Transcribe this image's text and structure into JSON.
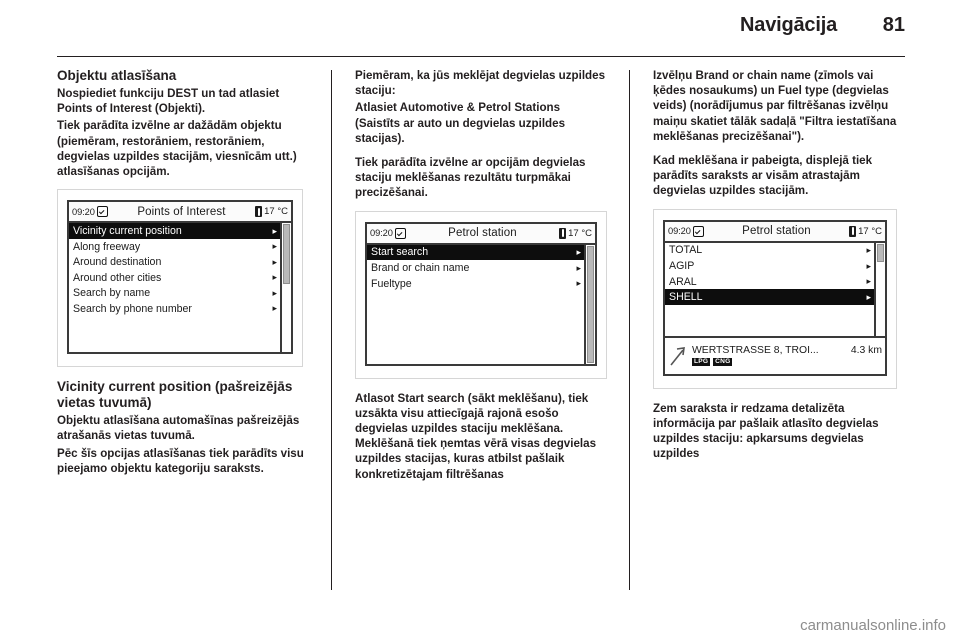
{
  "header": {
    "title": "Navigācija",
    "page_number": "81"
  },
  "columns": {
    "col1": {
      "heading": "Objektu atlasīšana",
      "paragraphs": [
        "Nospiediet funkciju DEST un tad atlasiet Points of Interest (Objekti).",
        "Tiek parādīta izvēlne ar dažādām objektu (piemēram, restorāniem, restorāniem, degvielas uzpildes stacijām, viesnīcām utt.) atlasīšanas opcijām."
      ],
      "heading2": "Vicinity current position (pašreizējās vietas tuvumā)",
      "paragraphs2": [
        "Objektu atlasīšana automašīnas pašreizējās atrašanās vietas tuvumā.",
        "Pēc šīs opcijas atlasīšanas tiek parādīts visu pieejamo objektu kategoriju saraksts."
      ]
    },
    "col2": {
      "paragraphs_top": [
        "Piemēram, ka jūs meklējat degvielas uzpildes staciju:",
        "Atlasiet Automotive & Petrol Stations (Saistīts ar auto un degvielas uzpildes stacijas).",
        "Tiek parādīta izvēlne ar opcijām degvielas staciju meklēšanas rezultātu turpmākai precizēšanai."
      ],
      "paragraphs_bottom": [
        "Atlasot Start search (sākt meklēšanu), tiek uzsākta visu attiecīgajā rajonā esošo degvielas uzpildes staciju meklēšana. Meklēšanā tiek ņemtas vērā visas degvielas uzpildes stacijas, kuras atbilst pašlaik konkretizētajam filtrēšanas"
      ]
    },
    "col3": {
      "paragraphs_top": [
        "Izvēlņu Brand or chain name (zīmols vai ķēdes nosaukums) un Fuel type (degvielas veids) (norādījumus par filtrēšanas izvēlņu maiņu skatiet tālāk sadaļā \"Filtra iestatīšana meklēšanas precizēšanai\").",
        "Kad meklēšana ir pabeigta, displejā tiek parādīts saraksts ar visām atrastajām degvielas uzpildes stacijām."
      ],
      "paragraphs_bottom": [
        "Zem saraksta ir redzama detalizēta informācija par pašlaik atlasīto degvielas uzpildes staciju: apkarsums degvielas uzpildes"
      ]
    }
  },
  "screenshots": {
    "poi": {
      "statusbar": {
        "clock": "09:20",
        "clock_icon": "clock-checkmark-icon",
        "title": "Points of Interest",
        "thermo_icon": "thermometer-icon",
        "temperature": "17 °C"
      },
      "rows": [
        {
          "label": "Vicinity current position",
          "selected": true,
          "chevron": "▸"
        },
        {
          "label": "Along freeway",
          "selected": false,
          "chevron": "▸"
        },
        {
          "label": "Around destination",
          "selected": false,
          "chevron": "▸"
        },
        {
          "label": "Around other cities",
          "selected": false,
          "chevron": "▸"
        },
        {
          "label": "Search by name",
          "selected": false,
          "chevron": "▸"
        },
        {
          "label": "Search by phone number",
          "selected": false,
          "chevron": "▸"
        }
      ]
    },
    "petrol_menu": {
      "statusbar": {
        "clock": "09:20",
        "clock_icon": "clock-checkmark-icon",
        "title": "Petrol station",
        "thermo_icon": "thermometer-icon",
        "temperature": "17 °C"
      },
      "rows": [
        {
          "label": "Start search",
          "selected": true,
          "chevron": "▸"
        },
        {
          "label": "Brand or chain name",
          "selected": false,
          "chevron": "▸"
        },
        {
          "label": "Fueltype",
          "selected": false,
          "chevron": "▸"
        }
      ]
    },
    "petrol_results": {
      "statusbar": {
        "clock": "09:20",
        "clock_icon": "clock-checkmark-icon",
        "title": "Petrol station",
        "thermo_icon": "thermometer-icon",
        "temperature": "17 °C"
      },
      "rows": [
        {
          "label": "TOTAL",
          "selected": false,
          "chevron": "▸"
        },
        {
          "label": "AGIP",
          "selected": false,
          "chevron": "▸"
        },
        {
          "label": "ARAL",
          "selected": false,
          "chevron": "▸"
        },
        {
          "label": "SHELL",
          "selected": true,
          "chevron": "▸"
        }
      ],
      "detail": {
        "direction_icon": "arrow-northeast-icon",
        "address": "WERTSTRASSE  8, TROI...",
        "distance": "4.3 km",
        "badges": [
          "LPG",
          "CNG"
        ]
      }
    }
  },
  "watermark": "carmanualsonline.info",
  "colors": {
    "text": "#231f20",
    "rule": "#231f20",
    "screen_border": "#3a3a3a",
    "selected_bg": "#0d0d0d",
    "watermark": "#8d8d8d"
  }
}
